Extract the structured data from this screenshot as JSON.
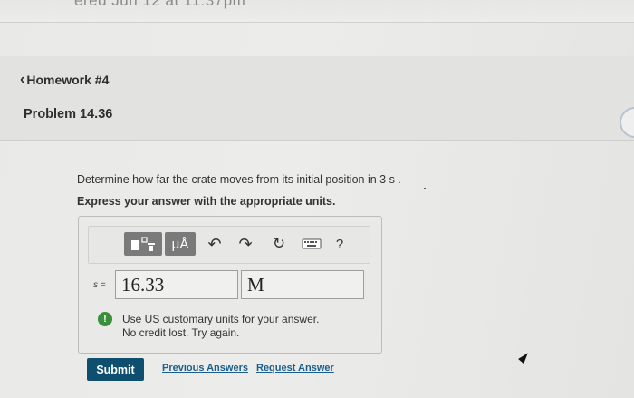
{
  "topbar": {
    "partial_text": "ered Jun 12 at 11:37pm"
  },
  "nav": {
    "back_label": "Homework #4"
  },
  "problem": {
    "title": "Problem 14.36",
    "prompt": "Determine how far the crate moves from its initial position in 3 s .",
    "instruction": "Express your answer with the appropriate units."
  },
  "toolbar": {
    "units_label": "μÅ",
    "help_label": "?",
    "icons": [
      "template-icon",
      "units-icon",
      "undo-icon",
      "redo-icon",
      "reset-icon",
      "keyboard-icon",
      "help-icon"
    ]
  },
  "answer": {
    "variable_label": "s =",
    "value": "16.33",
    "unit": "M"
  },
  "feedback": {
    "line1": "Use US customary units for your answer.",
    "line2": "No credit lost. Try again.",
    "status_color": "#3a8f3a"
  },
  "actions": {
    "submit_label": "Submit",
    "previous_answers_label": "Previous Answers",
    "request_answer_label": "Request Answer",
    "accent_color": "#0e4f6f"
  }
}
